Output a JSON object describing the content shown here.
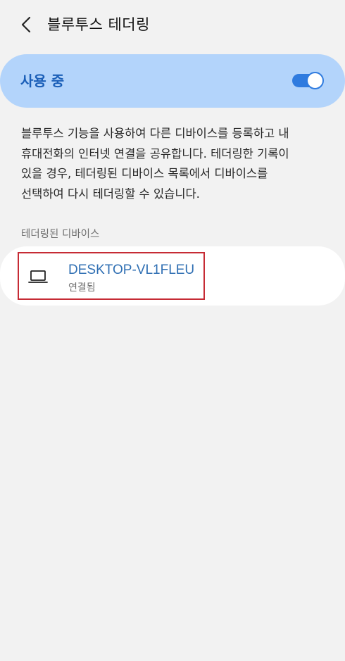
{
  "header": {
    "title": "블루투스 테더링",
    "back_icon": "chevron-left-icon"
  },
  "toggle": {
    "label": "사용 중",
    "state": "on",
    "accent_color": "#2f7bdf",
    "card_color": "#b3d4fb"
  },
  "description": {
    "lines": [
      "블루투스 기능을 사용하여 다른 디바이스를 등록하고 내",
      "휴대전화의 인터넷 연결을 공유합니다. 테더링한 기록이",
      "있을 경우, 테더링된 디바이스 목록에서 디바이스를",
      "선택하여 다시 테더링할 수 있습니다."
    ]
  },
  "tethered_devices": {
    "section_title": "테더링된 디바이스",
    "items": [
      {
        "name": "DESKTOP-VL1FLEU",
        "status": "연결됨",
        "icon": "laptop-icon"
      }
    ]
  }
}
